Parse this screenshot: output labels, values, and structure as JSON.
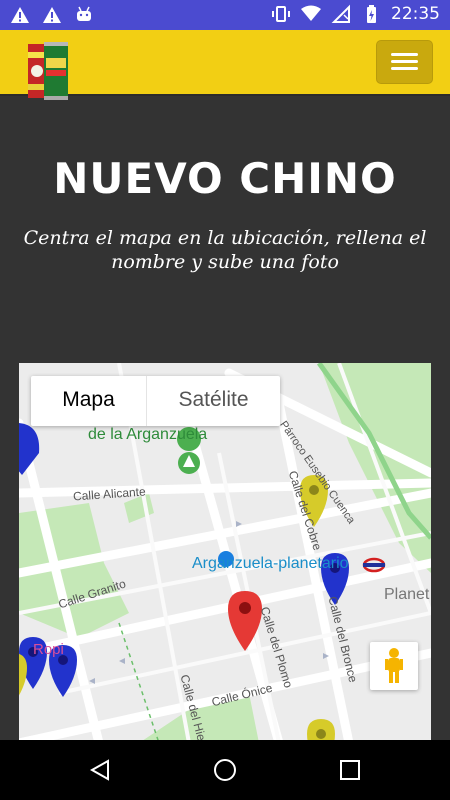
{
  "status_bar": {
    "time": "22:35",
    "left_icons": [
      "warning-icon",
      "warning-icon",
      "android-icon"
    ],
    "right_icons": [
      "vibrate-icon",
      "wifi-icon",
      "no-sim-icon",
      "battery-charging-icon"
    ]
  },
  "header": {
    "logo_icon": "app-logo-icon",
    "menu_icon": "hamburger-icon"
  },
  "hero": {
    "title": "NUEVO CHINO",
    "subtitle": "Centra el mapa en la ubicación, rellena el nombre y sube una foto"
  },
  "map": {
    "type_control": {
      "map_label": "Mapa",
      "satellite_label": "Satélite",
      "selected": "Mapa"
    },
    "labels": {
      "park": "de la Arganzuela",
      "street_alicante": "Calle Alicante",
      "street_cobre": "Calle del Cobre",
      "parroco": "Párroco Eusebio Cuenca",
      "metro": "Arganzuela-planetario",
      "planet": "Planet",
      "street_granito": "Calle Granito",
      "street_plomo": "Calle del Plomo",
      "street_bronce": "Calle del Bronce",
      "street_onice": "Calle Ónice",
      "street_hierro": "Calle del Hie",
      "pink": "Ropi"
    },
    "colors": {
      "center_marker": "#e53935",
      "blue_marker": "#2233cc",
      "yellow_marker": "#d6cb2a",
      "park": "#c5e8b7",
      "metro_text": "#1a8ec9"
    }
  },
  "nav_bar": {
    "back_icon": "back-icon",
    "home_icon": "home-icon",
    "recents_icon": "recents-icon"
  }
}
